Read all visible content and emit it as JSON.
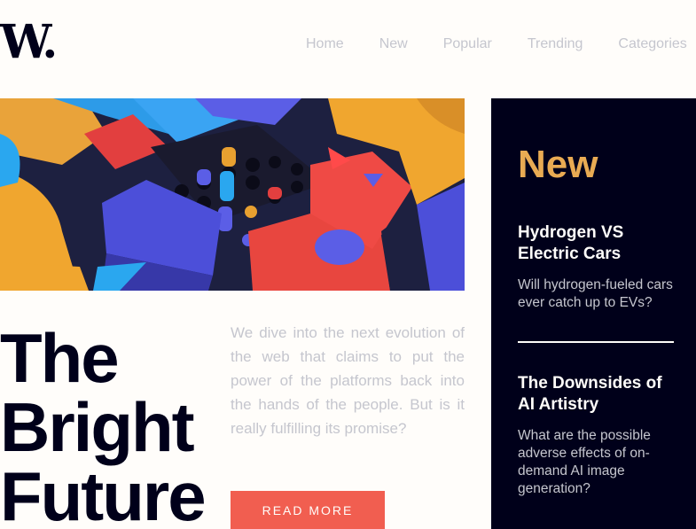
{
  "header": {
    "logo": "W.",
    "nav": [
      "Home",
      "New",
      "Popular",
      "Trending",
      "Categories"
    ]
  },
  "hero": {
    "headline": "The\nBright\nFuture",
    "intro": "We dive into the next evolution of the web that claims to put the power of the platforms back into the hands of the people. But is it really fulfilling its promise?",
    "cta": "READ MORE"
  },
  "sidebar": {
    "title": "New",
    "articles": [
      {
        "title": "Hydrogen VS Electric Cars",
        "desc": "Will hydrogen-fueled cars ever catch up to EVs?"
      },
      {
        "title": "The Downsides of AI Artistry",
        "desc": "What are the possible adverse effects of on-demand AI image generation?"
      }
    ]
  },
  "colors": {
    "background": "#fffdfa",
    "dark": "#00001a",
    "accent_orange": "#e9ab53",
    "accent_red": "#f15e50",
    "muted": "#c5c6ce"
  }
}
